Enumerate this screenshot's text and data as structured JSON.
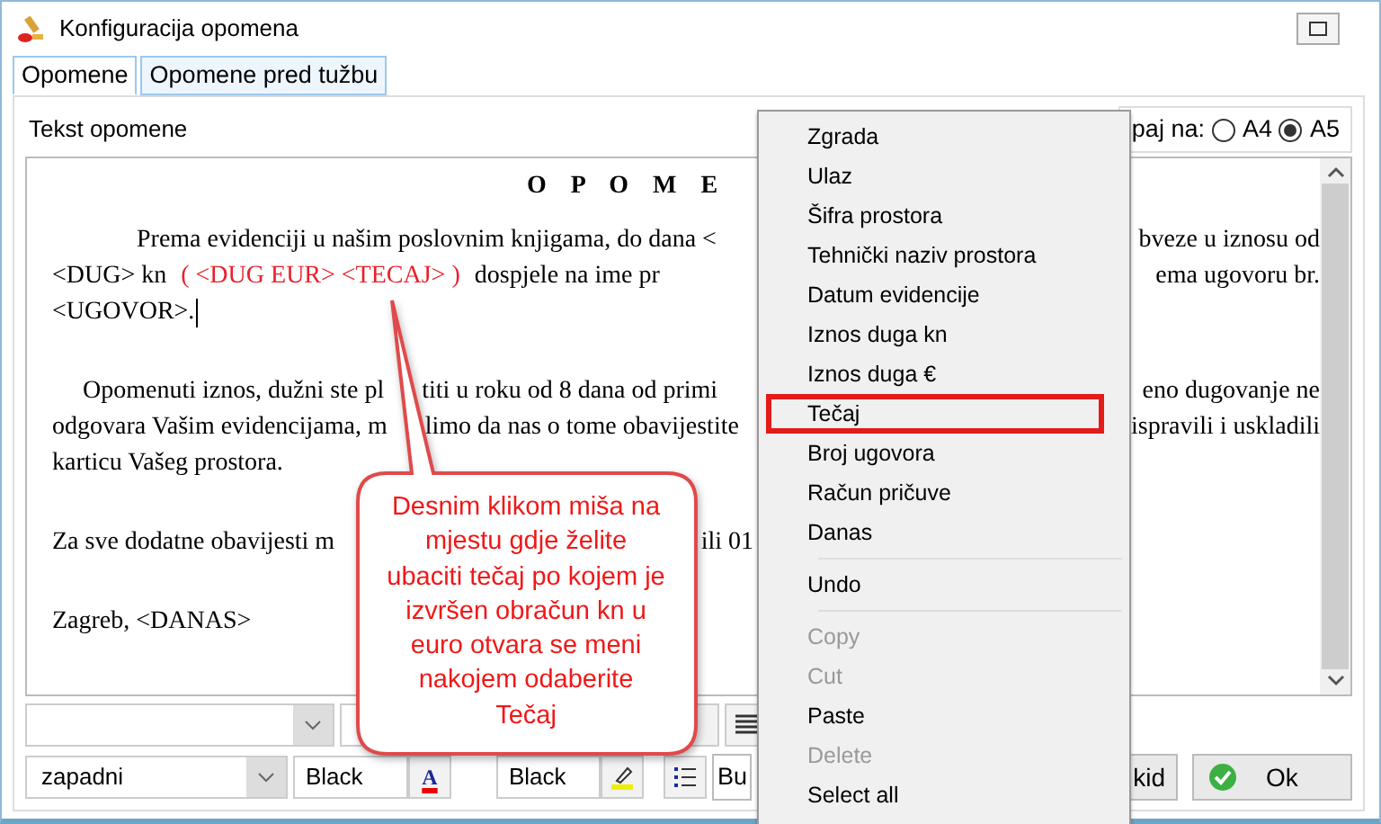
{
  "window": {
    "title": "Konfiguracija opomena"
  },
  "tabs": [
    {
      "label": "Opomene",
      "selected": true
    },
    {
      "label": "Opomene pred tužbu",
      "selected": false
    }
  ],
  "editor_label": "Tekst opomene",
  "paper_format": {
    "label": "paj na:",
    "options": [
      {
        "label": "A4",
        "selected": false
      },
      {
        "label": "A5",
        "selected": true
      }
    ]
  },
  "document": {
    "title": "O P O M E",
    "lines": [
      {
        "kind": "lead",
        "left": [
          {
            "text": "Prema evidenciji u našim poslovnim knjigama, do dana <",
            "highlighted": false
          }
        ],
        "right": "bveze u iznosu od"
      },
      {
        "kind": "text",
        "left": [
          {
            "text": "<DUG> kn",
            "highlighted": false
          },
          {
            "text": "( <DUG EUR> <TECAJ> )",
            "highlighted": true
          },
          {
            "text": "dospjele na ime pr",
            "highlighted": false
          }
        ],
        "right": "ema ugovoru br."
      },
      {
        "kind": "text",
        "cursor": true,
        "left": [
          {
            "text": "<UGOVOR>.",
            "highlighted": false
          }
        ]
      },
      {
        "kind": "blank"
      },
      {
        "kind": "indented",
        "left": [
          {
            "text": "Opomenuti iznos, dužni ste pl",
            "highlighted": false
          },
          {
            "text": "titi u roku od 8 dana od primi",
            "highlighted": false
          }
        ],
        "right": "eno dugovanje ne"
      },
      {
        "kind": "text",
        "left": [
          {
            "text": "odgovara Vašim evidencijama, m",
            "highlighted": false
          },
          {
            "text": "limo da nas o tome obavijestite",
            "highlighted": false
          }
        ],
        "right": "ispravili i uskladili"
      },
      {
        "kind": "text",
        "left": [
          {
            "text": "karticu Vašeg prostora.",
            "highlighted": false
          }
        ]
      },
      {
        "kind": "blank"
      },
      {
        "kind": "text",
        "left": [
          {
            "text": "Za sve dodatne obavijesti m",
            "highlighted": false
          }
        ],
        "left_end": "ili 01"
      },
      {
        "kind": "blank"
      },
      {
        "kind": "text",
        "left": [
          {
            "text": "Zagreb, <DANAS>",
            "highlighted": false
          }
        ]
      }
    ]
  },
  "toolbar": {
    "encoding": "zapadni",
    "font_color": "Black",
    "font_color_icon": "A",
    "highlight_color": "Black",
    "partial_button": "Bu"
  },
  "buttons": [
    {
      "label": "kid",
      "kind": "plain"
    },
    {
      "label": "Ok",
      "kind": "confirm"
    }
  ],
  "context_menu": {
    "items": [
      {
        "kind": "item",
        "label": "Zgrada",
        "disabled": false,
        "highlighted": false
      },
      {
        "kind": "item",
        "label": "Ulaz",
        "disabled": false,
        "highlighted": false
      },
      {
        "kind": "item",
        "label": "Šifra prostora",
        "disabled": false,
        "highlighted": false
      },
      {
        "kind": "item",
        "label": "Tehnički naziv prostora",
        "disabled": false,
        "highlighted": false
      },
      {
        "kind": "item",
        "label": "Datum evidencije",
        "disabled": false,
        "highlighted": false
      },
      {
        "kind": "item",
        "label": "Iznos duga kn",
        "disabled": false,
        "highlighted": false
      },
      {
        "kind": "item",
        "label": "Iznos duga €",
        "disabled": false,
        "highlighted": false
      },
      {
        "kind": "item",
        "label": "Tečaj",
        "disabled": false,
        "highlighted": true
      },
      {
        "kind": "item",
        "label": "Broj ugovora",
        "disabled": false,
        "highlighted": false
      },
      {
        "kind": "item",
        "label": "Račun pričuve",
        "disabled": false,
        "highlighted": false
      },
      {
        "kind": "item",
        "label": "Danas",
        "disabled": false,
        "highlighted": false
      },
      {
        "kind": "separator"
      },
      {
        "kind": "item",
        "label": "Undo",
        "disabled": false,
        "highlighted": false
      },
      {
        "kind": "separator"
      },
      {
        "kind": "item",
        "label": "Copy",
        "disabled": true,
        "highlighted": false
      },
      {
        "kind": "item",
        "label": "Cut",
        "disabled": true,
        "highlighted": false
      },
      {
        "kind": "item",
        "label": "Paste",
        "disabled": false,
        "highlighted": false
      },
      {
        "kind": "item",
        "label": "Delete",
        "disabled": true,
        "highlighted": false
      },
      {
        "kind": "item",
        "label": "Select all",
        "disabled": false,
        "highlighted": false
      }
    ]
  },
  "callout": {
    "text": "Desnim klikom miša na mjestu gdje želite ubaciti tečaj po kojem je izvršen obračun kn u euro otvara se meni nakojem odaberite Tečaj"
  }
}
